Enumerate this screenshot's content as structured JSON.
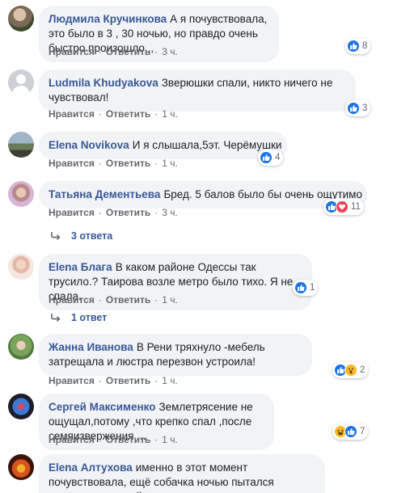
{
  "comments": [
    {
      "author": "Людмила Кручинкова",
      "text": "А я почувствовала, это было в 3 , 30 ночью, но правдо очень быстро произошло,,,",
      "actions": {
        "like": "Нравится",
        "reply": "Ответить",
        "time": "3 ч."
      },
      "reactions": {
        "types": [
          "like"
        ],
        "count": "8"
      }
    },
    {
      "author": "Ludmila Khudyakova",
      "text": "Зверюшки спали, никто ничего не чувствовал!",
      "actions": {
        "like": "Нравится",
        "reply": "Ответить",
        "time": "1 ч."
      },
      "reactions": {
        "types": [
          "like"
        ],
        "count": "3"
      }
    },
    {
      "author": "Elena Novikova",
      "text": "И я слышала,5эт. Черёмушки",
      "actions": {
        "like": "Нравится",
        "reply": "Ответить",
        "time": "1 ч."
      },
      "reactions": {
        "types": [
          "like"
        ],
        "count": "4"
      }
    },
    {
      "author": "Татьяна Дементьева",
      "text": "Бред. 5 балов было бы очень ощутимо",
      "actions": {
        "like": "Нравится",
        "reply": "Ответить",
        "time": "3 ч."
      },
      "reactions": {
        "types": [
          "like",
          "love"
        ],
        "count": "11"
      },
      "replies_link": "3 ответа"
    },
    {
      "author": "Elena Блага",
      "text": "В каком районе Одессы так трусило.? Таирова возле метро было тихо. Я не спала.",
      "actions": {
        "like": "Нравится",
        "reply": "Ответить",
        "time": "1 ч."
      },
      "reactions": {
        "types": [
          "like"
        ],
        "count": "1"
      },
      "replies_link": "1 ответ"
    },
    {
      "author": "Жанна Иванова",
      "text": "В Рени тряхнуло -мебель затрещала и люстра перезвон устроила!",
      "actions": {
        "like": "Нравится",
        "reply": "Ответить",
        "time": "1 ч."
      },
      "reactions": {
        "types": [
          "like",
          "wow"
        ],
        "count": "2"
      }
    },
    {
      "author": "Сергей Максименко",
      "text": "Землетрясение не ощущал,потому ,что крепко спал ,после семяизвержения....",
      "actions": {
        "like": "Нравится",
        "reply": "Ответить",
        "time": "1 ч."
      },
      "reactions": {
        "types": [
          "haha",
          "like"
        ],
        "count": "7"
      }
    },
    {
      "author": "Elena Алтухова",
      "text": "именно в этот момент почувствовала, ещё собачка ночью пытался спрятаться в моей комнате",
      "actions": {}
    }
  ],
  "colors": {
    "author": "#385898",
    "bubble": "#f2f3f5",
    "like": "#1b74e4",
    "love": "#f33e58",
    "wow": "#f7b928",
    "meta": "#65676b"
  }
}
